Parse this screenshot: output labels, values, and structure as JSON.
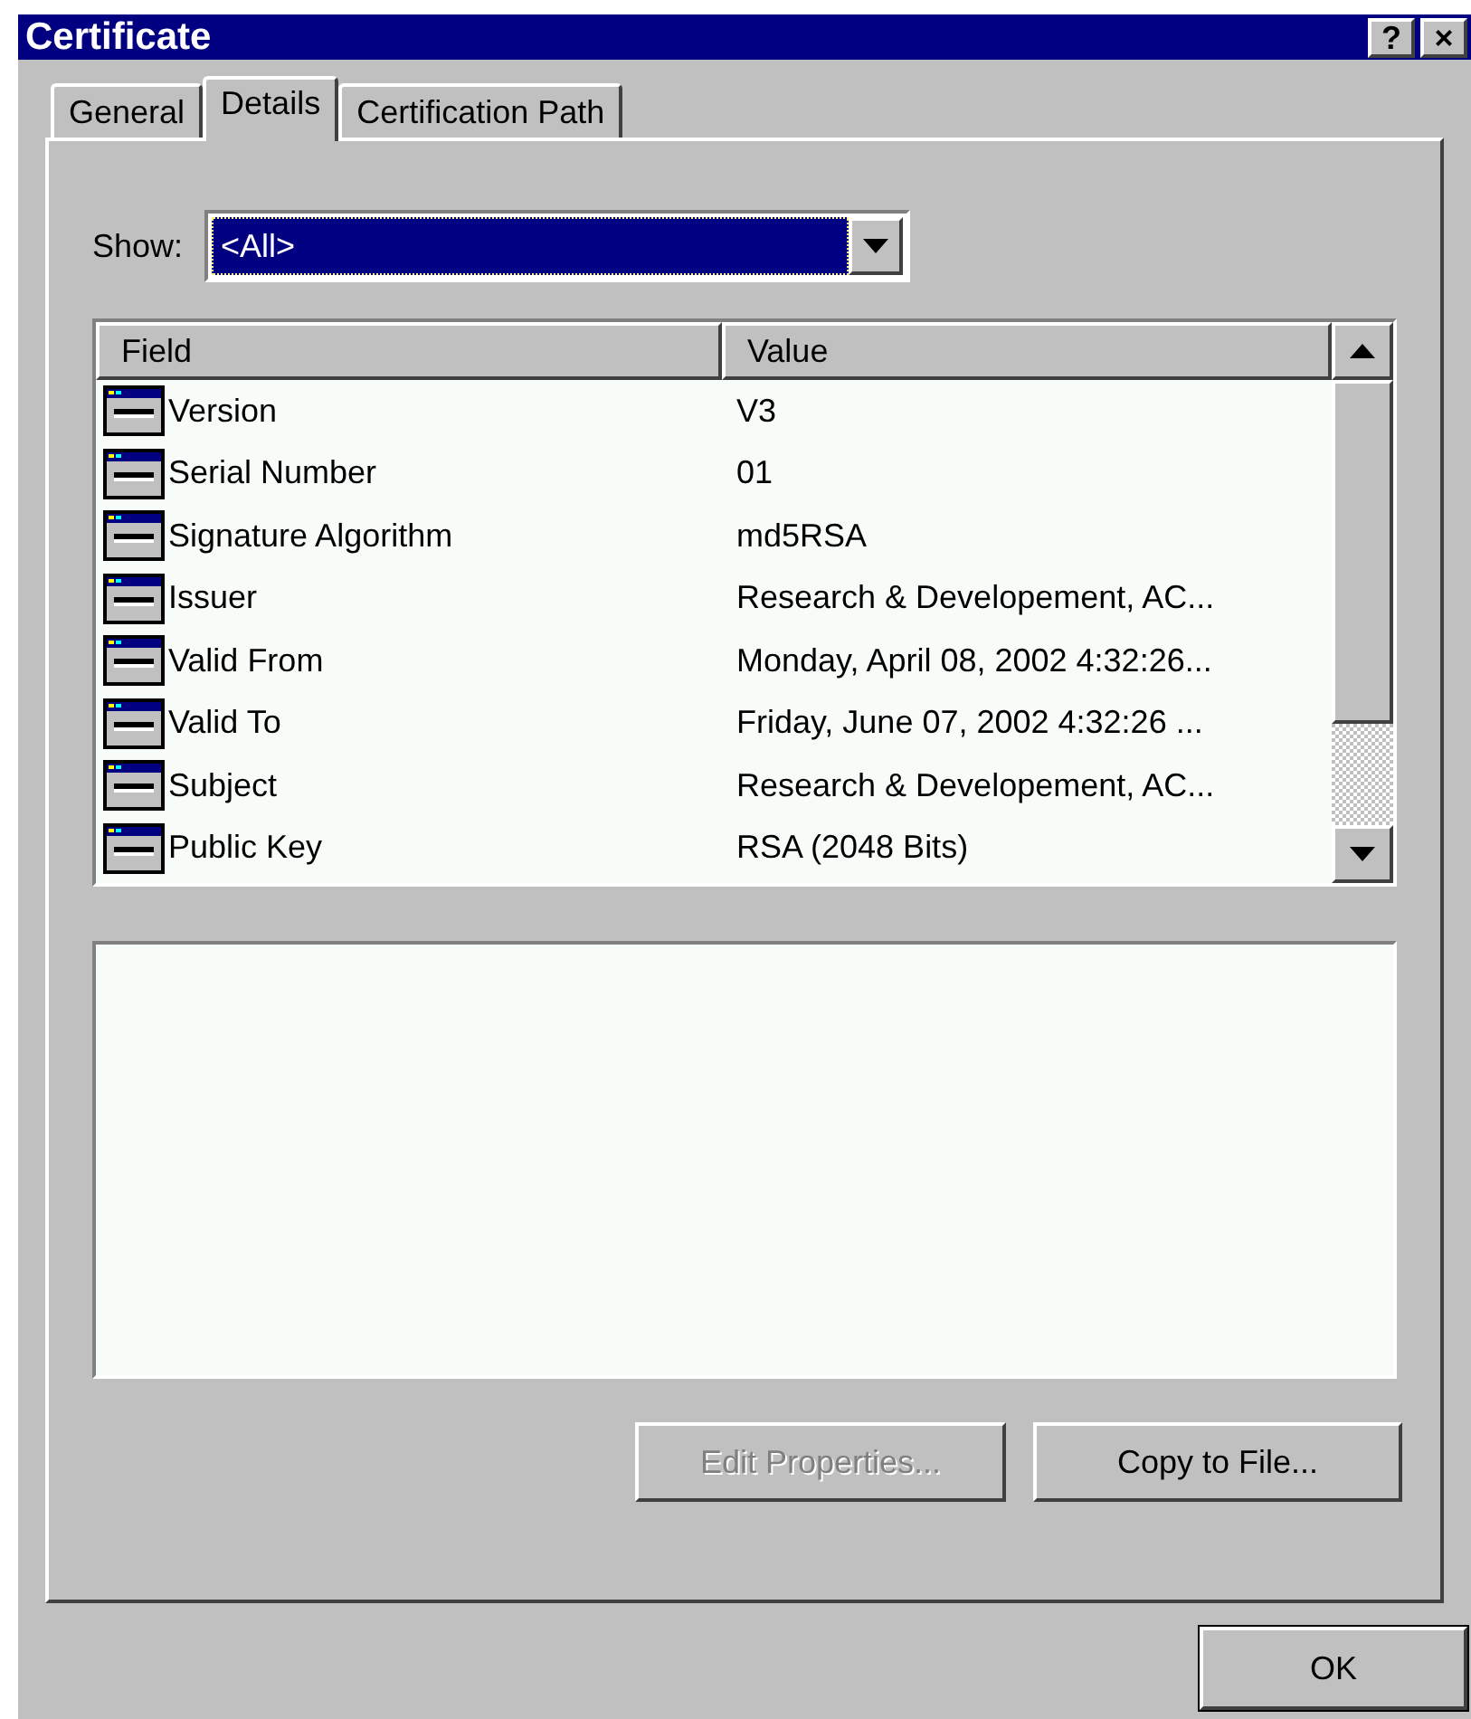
{
  "window": {
    "title": "Certificate",
    "controls": [
      "?",
      "×"
    ]
  },
  "tabs": [
    {
      "label": "General",
      "selected": false
    },
    {
      "label": "Details",
      "selected": true
    },
    {
      "label": "Certification Path",
      "selected": false
    }
  ],
  "show": {
    "label": "Show:",
    "value": "<All>"
  },
  "table": {
    "columns": [
      "Field",
      "Value"
    ],
    "rows": [
      {
        "field": "Version",
        "value": "V3"
      },
      {
        "field": "Serial Number",
        "value": "01"
      },
      {
        "field": "Signature Algorithm",
        "value": "md5RSA"
      },
      {
        "field": "Issuer",
        "value": "Research & Developement, AC..."
      },
      {
        "field": "Valid From",
        "value": "Monday, April 08, 2002 4:32:26..."
      },
      {
        "field": "Valid To",
        "value": "Friday, June 07, 2002 4:32:26 ..."
      },
      {
        "field": "Subject",
        "value": "Research & Developement, AC..."
      },
      {
        "field": "Public Key",
        "value": "RSA (2048 Bits)"
      }
    ]
  },
  "buttons": [
    {
      "label": "Edit Properties...",
      "disabled": true
    },
    {
      "label": "Copy to File...",
      "disabled": false
    }
  ],
  "ok_button": {
    "label": "OK"
  }
}
